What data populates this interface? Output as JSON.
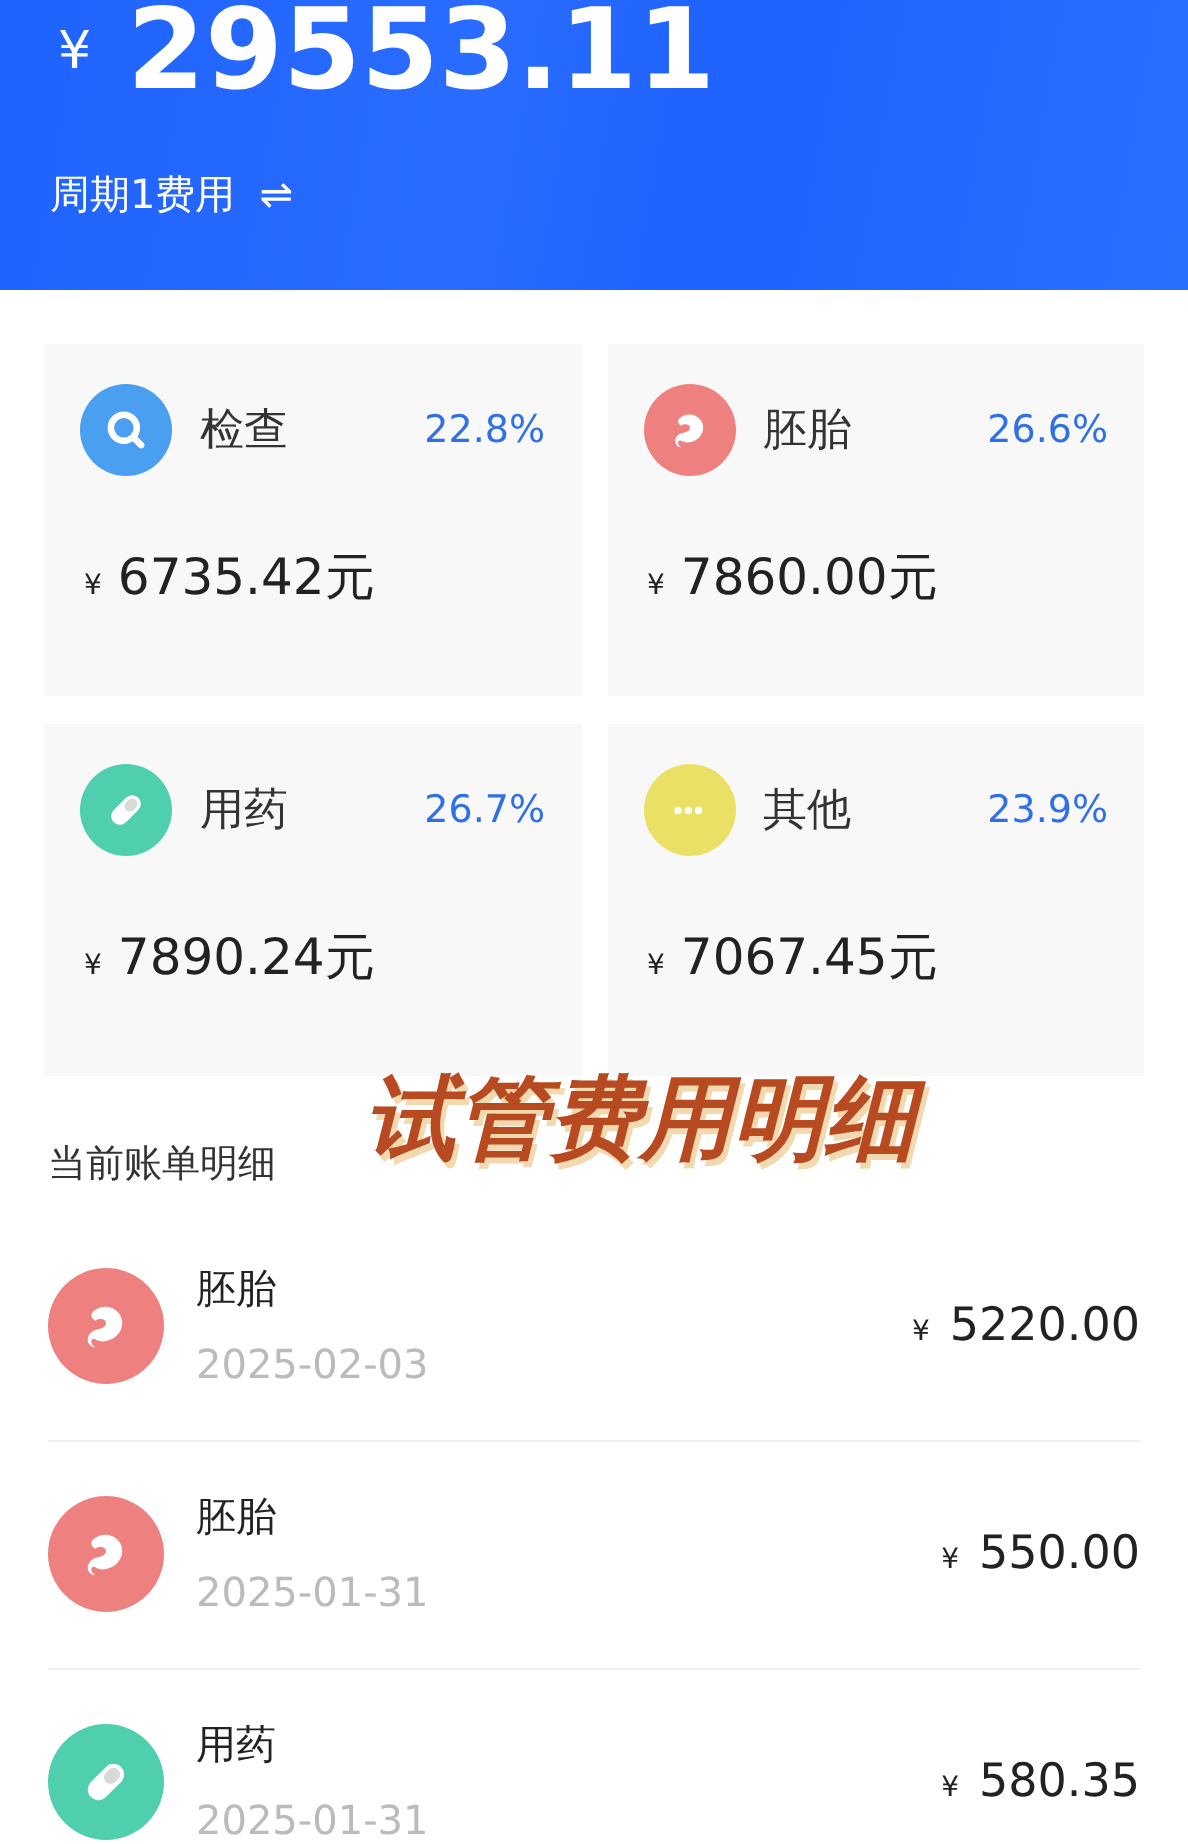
{
  "header": {
    "currency": "¥",
    "total": "29553.11",
    "period": "周期1费用",
    "switch_icon": "⇌"
  },
  "categories": [
    {
      "kind": "search",
      "name": "检查",
      "percent": "22.8%",
      "currency": "¥",
      "amount": "6735.42元",
      "color": "#4a9ff0"
    },
    {
      "kind": "embryo",
      "name": "胚胎",
      "percent": "26.6%",
      "currency": "¥",
      "amount": "7860.00元",
      "color": "#ee8080"
    },
    {
      "kind": "pill",
      "name": "用药",
      "percent": "26.7%",
      "currency": "¥",
      "amount": "7890.24元",
      "color": "#4fcfad"
    },
    {
      "kind": "more",
      "name": "其他",
      "percent": "23.9%",
      "currency": "¥",
      "amount": "7067.45元",
      "color": "#ebe066"
    }
  ],
  "bills_title": "当前账单明细",
  "caption": "试管费用明细",
  "bills": [
    {
      "kind": "embryo",
      "name": "胚胎",
      "date": "2025-02-03",
      "currency": "¥",
      "amount": "5220.00",
      "color": "#ee8080"
    },
    {
      "kind": "embryo",
      "name": "胚胎",
      "date": "2025-01-31",
      "currency": "¥",
      "amount": "550.00",
      "color": "#ee8080"
    },
    {
      "kind": "pill",
      "name": "用药",
      "date": "2025-01-31",
      "currency": "¥",
      "amount": "580.35",
      "color": "#4fcfad"
    }
  ]
}
